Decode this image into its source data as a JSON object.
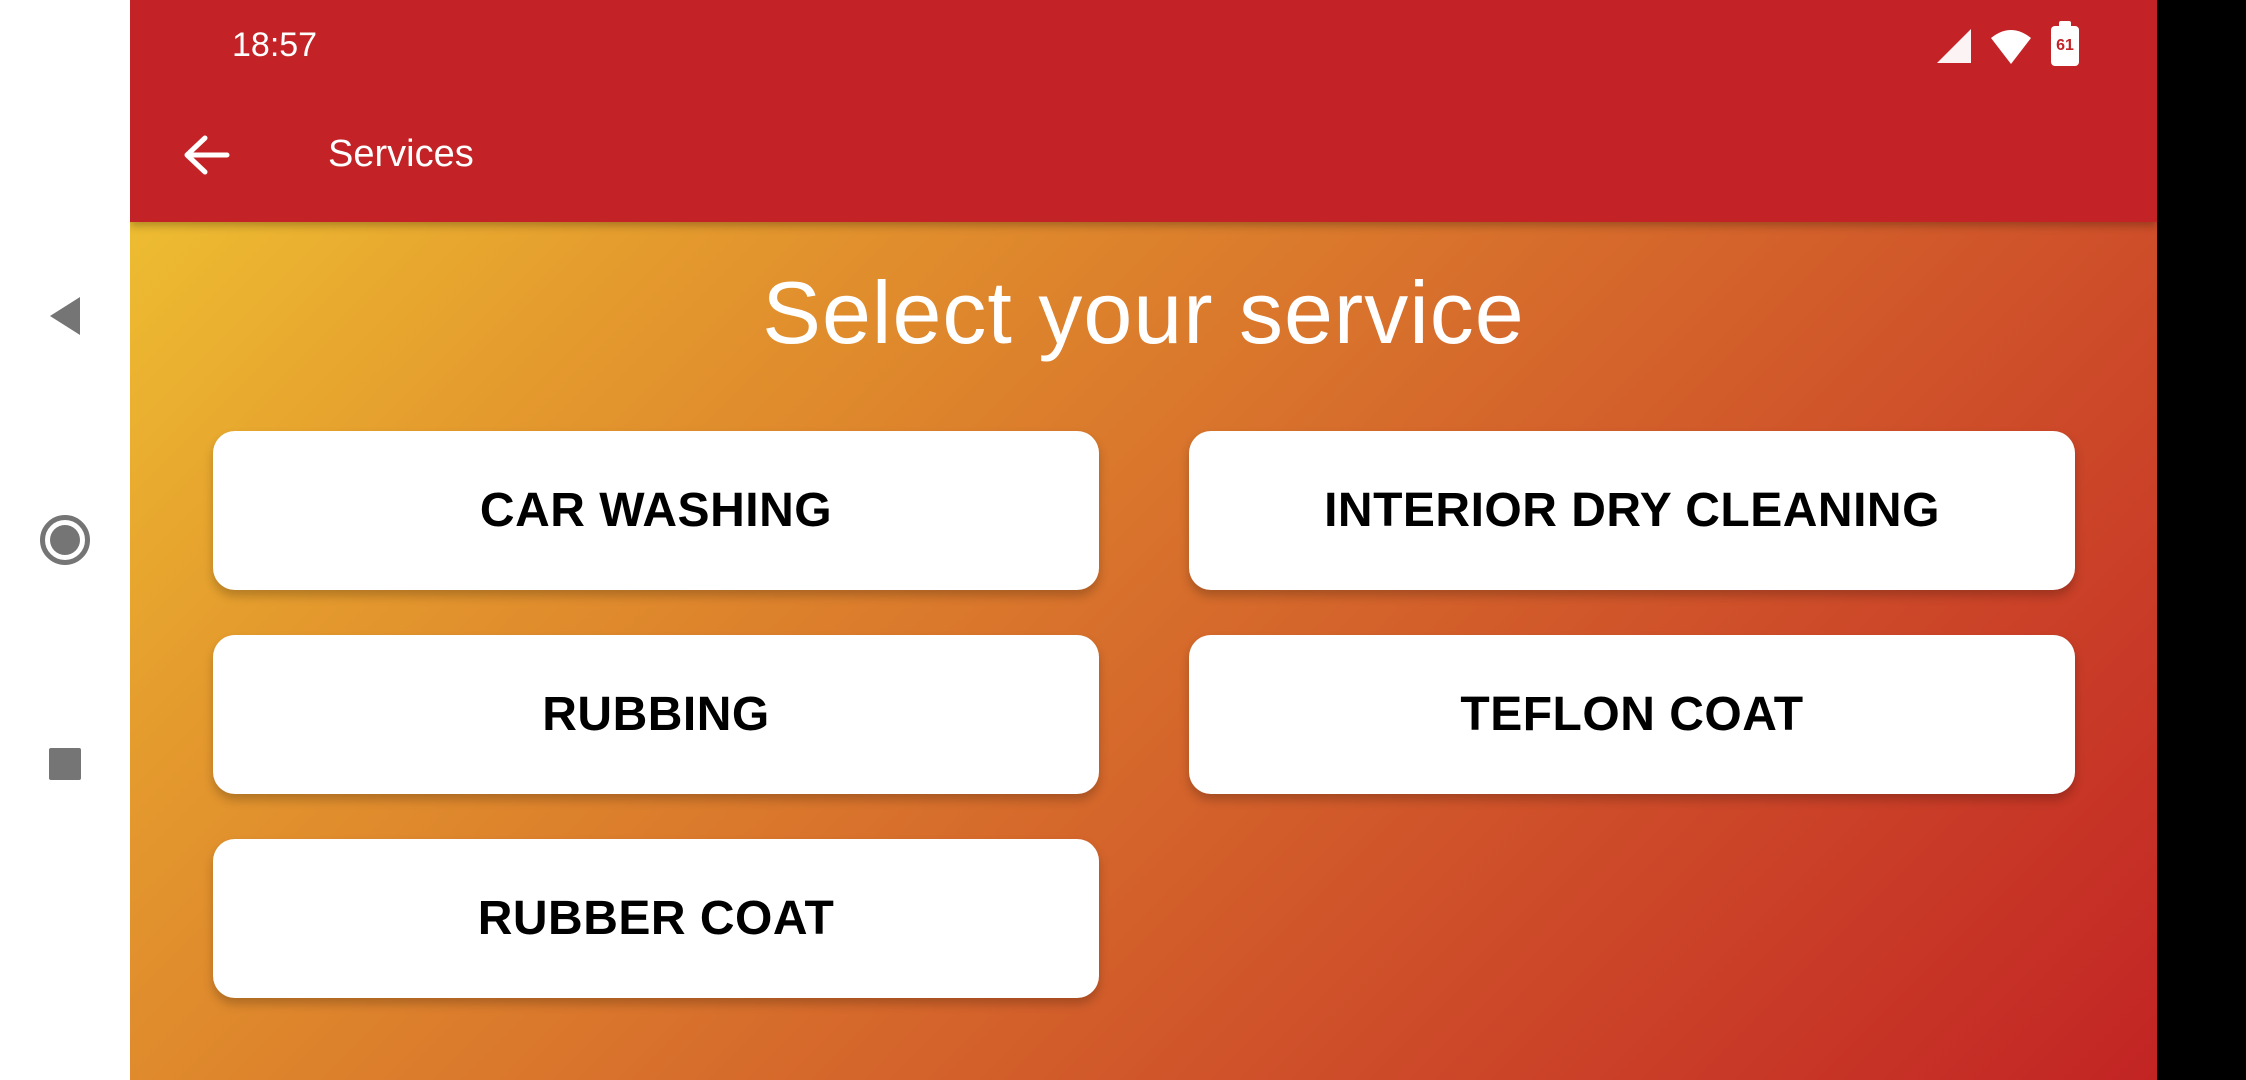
{
  "status_bar": {
    "time": "18:57",
    "battery_level": "61",
    "icons": [
      "signal-icon",
      "wifi-icon",
      "battery-icon"
    ]
  },
  "toolbar": {
    "title": "Services",
    "back_icon": "arrow-left-icon"
  },
  "main": {
    "heading": "Select your service",
    "services": [
      "CAR WASHING",
      "INTERIOR DRY CLEANING",
      "RUBBING",
      "TEFLON COAT",
      "RUBBER COAT"
    ]
  },
  "navigation_bar": {
    "icons": [
      "nav-back-icon",
      "nav-home-icon",
      "nav-recents-icon"
    ]
  },
  "colors": {
    "toolbar": "#c32326",
    "gradient_start": "#f1ca33",
    "gradient_end": "#c22424",
    "button_bg": "#ffffff"
  }
}
